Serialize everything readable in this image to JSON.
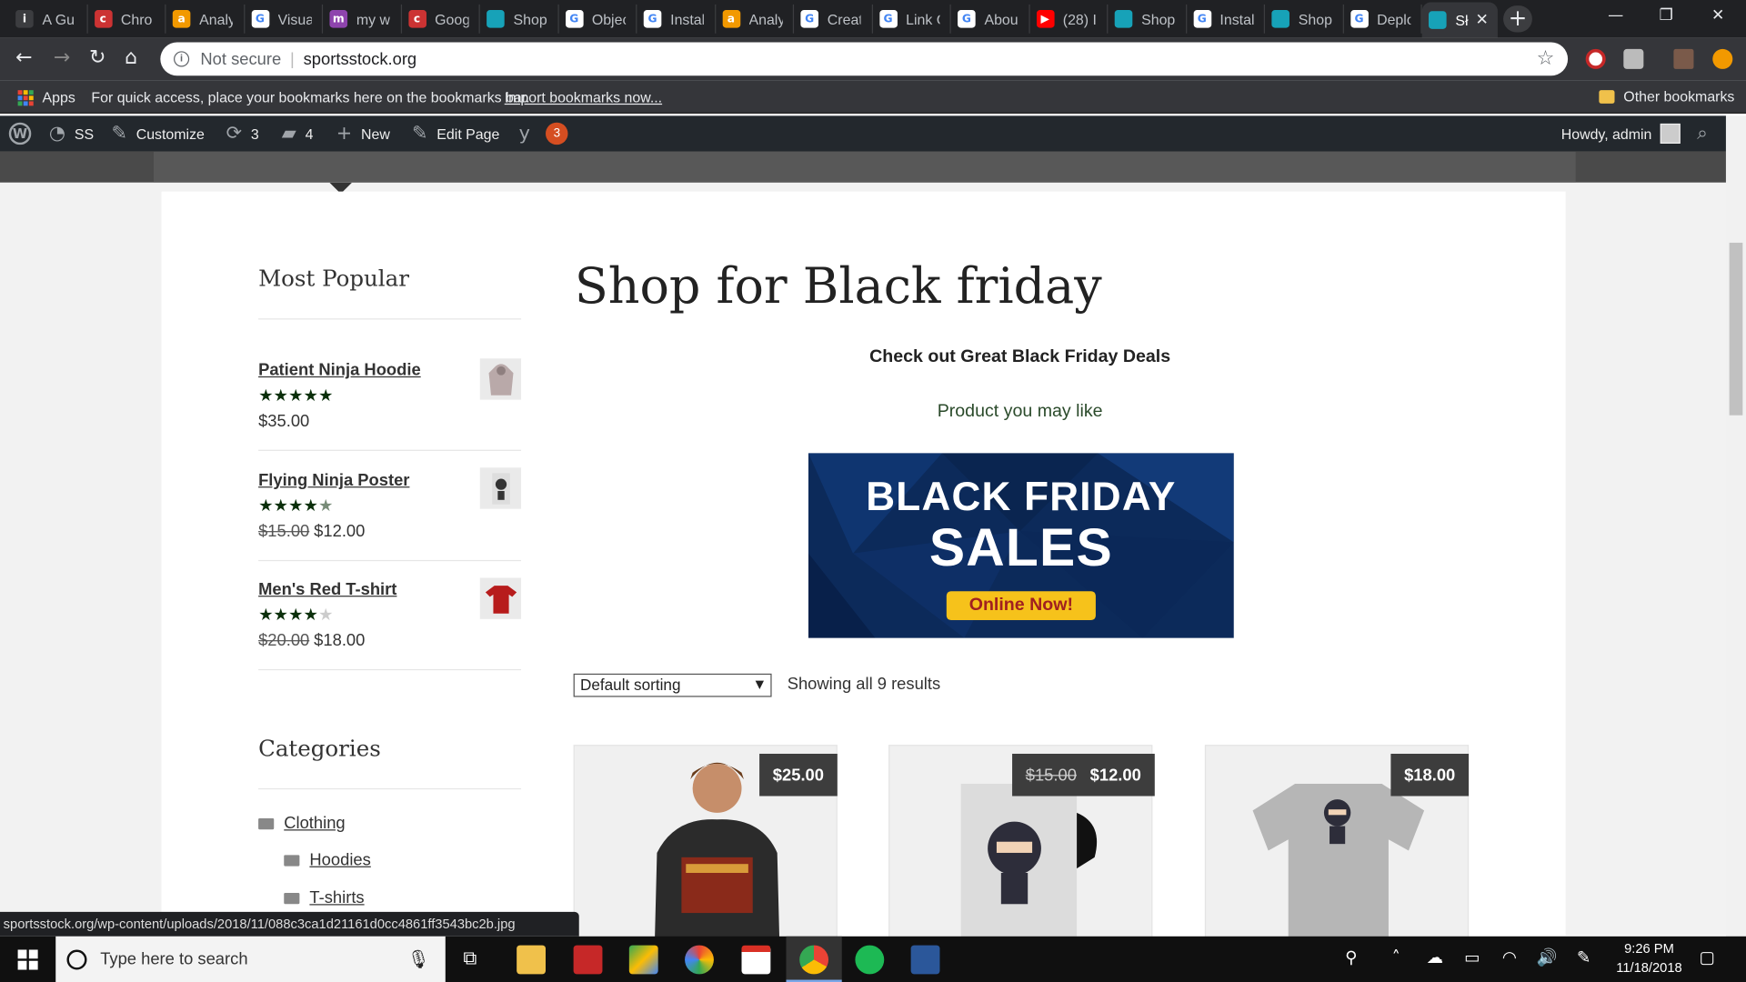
{
  "browser": {
    "tabs": [
      {
        "label": "A Gu",
        "color": "#3c3d40",
        "glyph": "i"
      },
      {
        "label": "Chro",
        "color": "#c33",
        "glyph": "c"
      },
      {
        "label": "Analy",
        "color": "#f29900",
        "glyph": "a"
      },
      {
        "label": "Visua",
        "color": "#ffffff",
        "glyph": "G"
      },
      {
        "label": "my w",
        "color": "#8e44ad",
        "glyph": "m"
      },
      {
        "label": "Goog",
        "color": "#c33",
        "glyph": "c"
      },
      {
        "label": "Shop",
        "color": "#17a2b8",
        "glyph": ""
      },
      {
        "label": "Objec",
        "color": "#ffffff",
        "glyph": "G"
      },
      {
        "label": "Instal",
        "color": "#ffffff",
        "glyph": "G"
      },
      {
        "label": "Analy",
        "color": "#f29900",
        "glyph": "a"
      },
      {
        "label": "Creat",
        "color": "#ffffff",
        "glyph": "G"
      },
      {
        "label": "Link C",
        "color": "#ffffff",
        "glyph": "G"
      },
      {
        "label": "Abou",
        "color": "#ffffff",
        "glyph": "G"
      },
      {
        "label": "(28) I",
        "color": "#ff0000",
        "glyph": "▶"
      },
      {
        "label": "Shop",
        "color": "#17a2b8",
        "glyph": ""
      },
      {
        "label": "Instal",
        "color": "#ffffff",
        "glyph": "G"
      },
      {
        "label": "Shop",
        "color": "#17a2b8",
        "glyph": ""
      },
      {
        "label": "Deplo",
        "color": "#ffffff",
        "glyph": "G"
      },
      {
        "label": "Sł",
        "color": "#17a2b8",
        "glyph": "",
        "active": true
      }
    ],
    "new_tab_label": "+",
    "address": {
      "security": "Not secure",
      "url": "sportsstock.org"
    },
    "bookmarks": {
      "apps": "Apps",
      "hint": "For quick access, place your bookmarks here on the bookmarks bar.",
      "import": "Import bookmarks now...",
      "other": "Other bookmarks"
    }
  },
  "wp_admin": {
    "site": "SS",
    "customize": "Customize",
    "updates": "3",
    "comments": "4",
    "new": "New",
    "edit": "Edit Page",
    "yoast_count": "3",
    "howdy": "Howdy, admin"
  },
  "sidebar": {
    "popular_heading": "Most Popular",
    "popular": [
      {
        "title": "Patient Ninja Hoodie",
        "rating": 5,
        "old_price": "",
        "price": "$35.00"
      },
      {
        "title": "Flying Ninja Poster",
        "rating": 4.5,
        "old_price": "$15.00",
        "price": "$12.00"
      },
      {
        "title": "Men's Red T-shirt",
        "rating": 4,
        "old_price": "$20.00",
        "price": "$18.00"
      }
    ],
    "categories_heading": "Categories",
    "categories": [
      "Clothing",
      "Hoodies",
      "T-shirts"
    ]
  },
  "main": {
    "title": "Shop for Black friday",
    "deals": "Check out Great Black Friday Deals",
    "may_like": "Product you may like",
    "banner": {
      "line1": "BLACK FRIDAY",
      "line2": "SALES",
      "button": "Online Now!"
    },
    "sorting": "Default sorting",
    "results": "Showing all 9 results",
    "products": [
      {
        "old_price": "",
        "price": "$25.00"
      },
      {
        "old_price": "$15.00",
        "price": "$12.00"
      },
      {
        "old_price": "",
        "price": "$18.00"
      }
    ]
  },
  "status_url": "sportsstock.org/wp-content/uploads/2018/11/088c3ca1d21161d0cc4861ff3543bc2b.jpg",
  "taskbar": {
    "search_placeholder": "Type here to search",
    "time": "9:26 PM",
    "date": "11/18/2018"
  }
}
